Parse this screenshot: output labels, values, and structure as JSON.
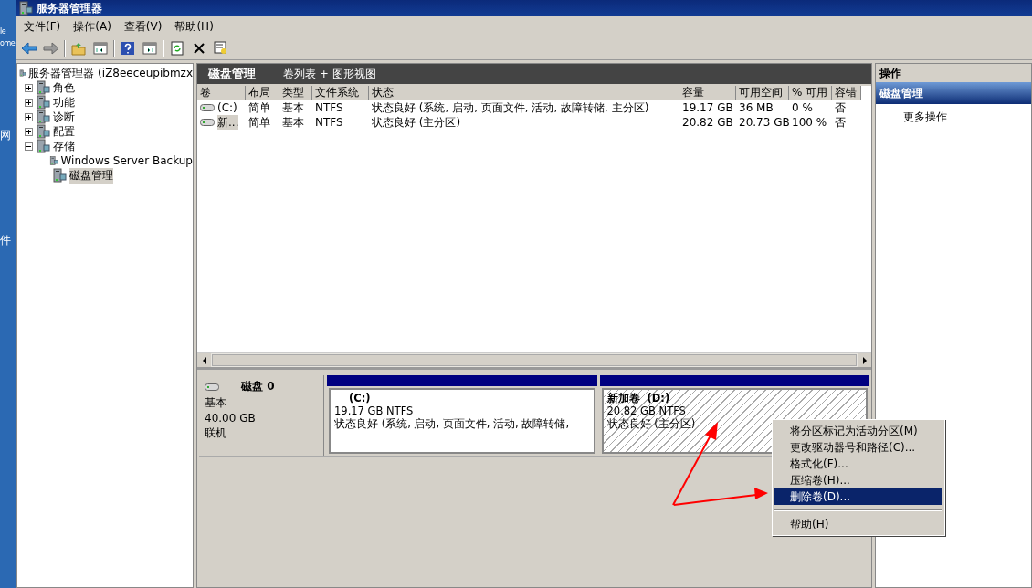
{
  "desktop": {
    "labels": [
      "le",
      "ome",
      "网",
      "件"
    ]
  },
  "window": {
    "title": "服务器管理器"
  },
  "menu": [
    "文件(F)",
    "操作(A)",
    "查看(V)",
    "帮助(H)"
  ],
  "tree": {
    "label": "服务器管理器 (iZ8eeceupibmzx",
    "children": [
      {
        "label": "角色",
        "expanded": false,
        "selected": false
      },
      {
        "label": "功能",
        "expanded": false,
        "selected": false
      },
      {
        "label": "诊断",
        "expanded": false,
        "selected": false
      },
      {
        "label": "配置",
        "expanded": false,
        "selected": false
      },
      {
        "label": "存储",
        "expanded": true,
        "selected": false,
        "children": [
          {
            "label": "Windows Server Backup",
            "selected": false
          },
          {
            "label": "磁盘管理",
            "selected": true
          }
        ]
      }
    ]
  },
  "center": {
    "title": "磁盘管理",
    "view": "卷列表 + 图形视图"
  },
  "table": {
    "columns": [
      "卷",
      "布局",
      "类型",
      "文件系统",
      "状态",
      "容量",
      "可用空间",
      "% 可用",
      "容错"
    ],
    "rows": [
      {
        "selected": false,
        "cells": [
          "(C:)",
          "简单",
          "基本",
          "NTFS",
          "状态良好 (系统, 启动, 页面文件, 活动, 故障转储, 主分区)",
          "19.17 GB",
          "36 MB",
          "0 %",
          "否"
        ]
      },
      {
        "selected": true,
        "cells": [
          "新...",
          "简单",
          "基本",
          "NTFS",
          "状态良好 (主分区)",
          "20.82 GB",
          "20.73 GB",
          "100 %",
          "否"
        ]
      }
    ]
  },
  "disks": [
    {
      "name": "磁盘 0",
      "type": "基本",
      "size": "40.00 GB",
      "status": "联机",
      "partitions": [
        {
          "name": "(C:)",
          "size": "19.17 GB NTFS",
          "status": "状态良好 (系统, 启动, 页面文件, 活动, 故障转储,",
          "hatched": false
        },
        {
          "name": "新加卷  (D:)",
          "size": "20.82 GB NTFS",
          "status": "状态良好 (主分区)",
          "hatched": true
        }
      ]
    }
  ],
  "actions": {
    "title": "操作",
    "section": "磁盘管理",
    "items": [
      "更多操作"
    ]
  },
  "context_menu": {
    "items": [
      {
        "kind": "item",
        "label": "将分区标记为活动分区(M)",
        "selected": false
      },
      {
        "kind": "item",
        "label": "更改驱动器号和路径(C)...",
        "selected": false
      },
      {
        "kind": "item",
        "label": "格式化(F)...",
        "selected": false
      },
      {
        "kind": "item",
        "label": "压缩卷(H)...",
        "selected": false
      },
      {
        "kind": "item",
        "label": "删除卷(D)...",
        "selected": true
      },
      {
        "kind": "separator"
      },
      {
        "kind": "item",
        "label": "帮助(H)",
        "selected": false
      }
    ]
  }
}
